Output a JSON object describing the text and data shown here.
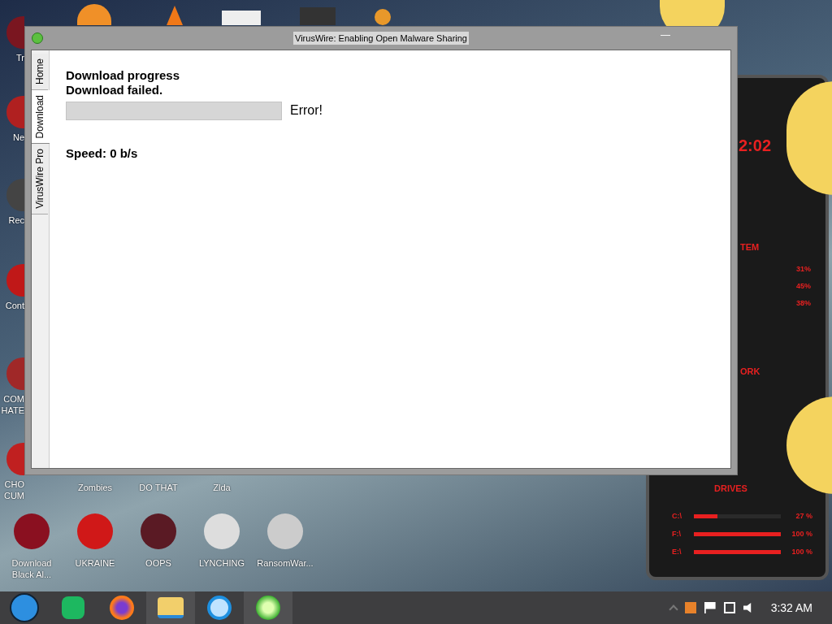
{
  "desktop_icons": [
    {
      "lines": [
        "Tr"
      ]
    },
    {
      "lines": [
        "Ne"
      ]
    },
    {
      "lines": [
        "Rec"
      ]
    },
    {
      "lines": [
        "Cont"
      ]
    },
    {
      "lines": [
        "COM",
        "HATE"
      ]
    },
    {
      "lines": [
        "CHO",
        "CUM"
      ]
    },
    {
      "lines": [
        "Zombies"
      ]
    },
    {
      "lines": [
        "DO THAT"
      ]
    },
    {
      "lines": [
        "Zlda"
      ]
    },
    {
      "lines": [
        "Download",
        "Black Al..."
      ]
    },
    {
      "lines": [
        "UKRAINE"
      ]
    },
    {
      "lines": [
        "OOPS"
      ]
    },
    {
      "lines": [
        "LYNCHING"
      ]
    },
    {
      "lines": [
        "RansomWar..."
      ]
    }
  ],
  "widget": {
    "clock": "2:02",
    "system_label": "TEM",
    "stats": [
      "31%",
      "45%",
      "38%"
    ],
    "network_label": "ORK",
    "drives_title": "DRIVES",
    "drives": [
      {
        "name": "C:\\",
        "reading": "27 %",
        "level": 0.27
      },
      {
        "name": "F:\\",
        "reading": "100 %",
        "level": 1
      },
      {
        "name": "E:\\",
        "reading": "100 %",
        "level": 1
      }
    ]
  },
  "window": {
    "title": "VirusWire: Enabling Open Malware Sharing",
    "minimize": "—"
  },
  "tabs": [
    {
      "label": "Home",
      "selected": false
    },
    {
      "label": "Download",
      "selected": true
    },
    {
      "label": "VirusWire Pro",
      "selected": false
    }
  ],
  "download": {
    "heading": "Download progress",
    "status": "Download failed.",
    "progress": {
      "level": 0
    },
    "progress_text": "Error!",
    "speed": "Speed: 0 b/s"
  },
  "taskbar": {
    "apps": [
      {
        "kind": "orb",
        "selected": false
      },
      {
        "kind": "chat",
        "selected": false
      },
      {
        "kind": "browser",
        "selected": false
      },
      {
        "kind": "folder",
        "selected": true
      },
      {
        "kind": "ie",
        "selected": false
      },
      {
        "kind": "virus",
        "selected": true
      }
    ],
    "clock": "3:32 AM"
  }
}
